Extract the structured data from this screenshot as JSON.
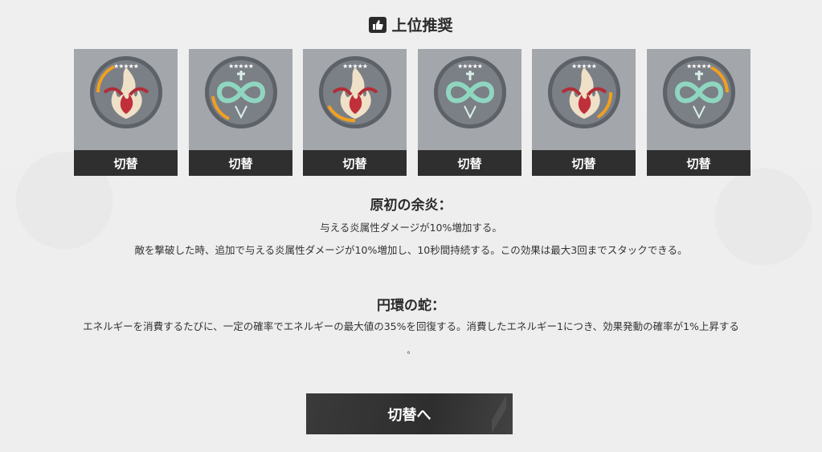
{
  "header": {
    "title": "上位推奨",
    "icon": "thumbs-up-icon"
  },
  "cards": [
    {
      "type": "flame",
      "stars": "★★★★★",
      "button": "切替"
    },
    {
      "type": "serpent",
      "stars": "★★★★★",
      "button": "切替"
    },
    {
      "type": "flame",
      "stars": "★★★★★",
      "button": "切替"
    },
    {
      "type": "serpent",
      "stars": "★★★★★",
      "button": "切替"
    },
    {
      "type": "flame",
      "stars": "★★★★★",
      "button": "切替"
    },
    {
      "type": "serpent",
      "stars": "★★★★★",
      "button": "切替"
    }
  ],
  "sets": [
    {
      "name": "原初の余炎：",
      "effects": [
        "与える炎属性ダメージが10%増加する。",
        "敵を撃破した時、追加で与える炎属性ダメージが10%増加し、10秒間持続する。この効果は最大3回までスタックできる。"
      ]
    },
    {
      "name": "円環の蛇：",
      "effects": [
        "エネルギーを消費するたびに、一定の確率でエネルギーの最大値の35%を回復する。消費したエネルギー1につき、効果発動の確率が1%上昇する",
        "。"
      ]
    }
  ],
  "footer": {
    "switch_button": "切替へ"
  },
  "colors": {
    "card_bg": "#a3a6ab",
    "card_footer": "#2f2f2f",
    "flame_accent": "#c0303a",
    "serpent_accent": "#8fd6c0",
    "ring_highlight": "#f0a020"
  }
}
